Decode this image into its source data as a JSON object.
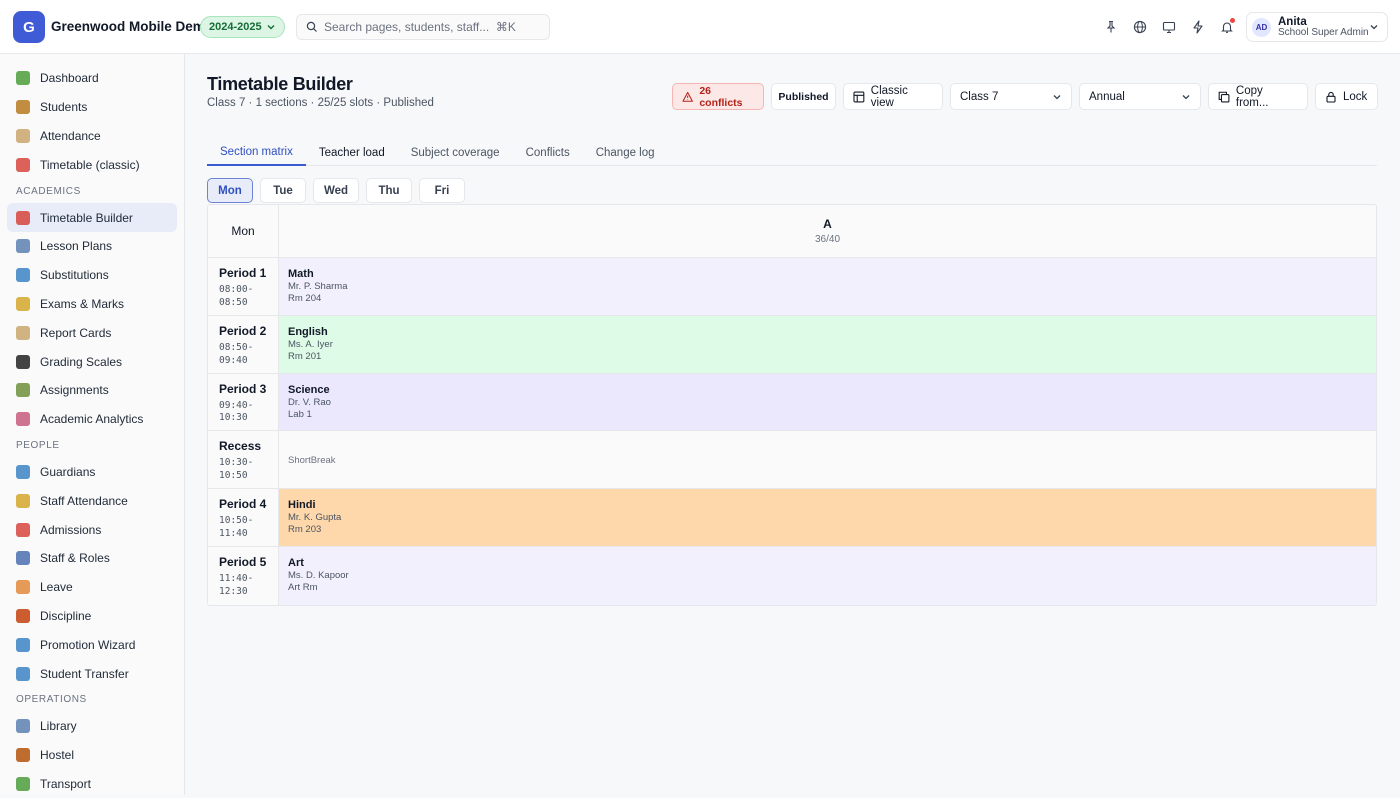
{
  "app": {
    "logo_letter": "G",
    "title": "Greenwood Mobile Demo",
    "year": "2024-2025"
  },
  "search": {
    "placeholder": "Search pages, students, staff...  ⌘K"
  },
  "user": {
    "initials": "AD",
    "name": "Anita",
    "role": "School Super Admin"
  },
  "sidebar": {
    "items_top": [
      {
        "label": "Dashboard",
        "icon": "chart-icon",
        "color": "#4a9c3b"
      },
      {
        "label": "Students",
        "icon": "student-icon",
        "color": "#b7791f"
      },
      {
        "label": "Attendance",
        "icon": "clipboard-icon",
        "color": "#c9a46b"
      },
      {
        "label": "Timetable (classic)",
        "icon": "calendar-icon",
        "color": "#d6453d"
      }
    ],
    "section_academics": "ACADEMICS",
    "items_academics": [
      {
        "label": "Timetable Builder",
        "icon": "calendar-icon",
        "color": "#d6453d"
      },
      {
        "label": "Lesson Plans",
        "icon": "book-icon",
        "color": "#5b7fb0"
      },
      {
        "label": "Substitutions",
        "icon": "refresh-icon",
        "color": "#3b82c4"
      },
      {
        "label": "Exams & Marks",
        "icon": "pencil-icon",
        "color": "#d4a72c"
      },
      {
        "label": "Report Cards",
        "icon": "clipboard-icon",
        "color": "#c9a46b"
      },
      {
        "label": "Grading Scales",
        "icon": "cap-icon",
        "color": "#222222"
      },
      {
        "label": "Assignments",
        "icon": "books-icon",
        "color": "#6c8f3a"
      },
      {
        "label": "Academic Analytics",
        "icon": "trend-icon",
        "color": "#c65b7c"
      }
    ],
    "section_people": "PEOPLE",
    "items_people": [
      {
        "label": "Guardians",
        "icon": "family-icon",
        "color": "#3b82c4"
      },
      {
        "label": "Staff Attendance",
        "icon": "staff-icon",
        "color": "#d4a72c"
      },
      {
        "label": "Admissions",
        "icon": "target-icon",
        "color": "#d6453d"
      },
      {
        "label": "Staff & Roles",
        "icon": "people-icon",
        "color": "#4b6fb0"
      },
      {
        "label": "Leave",
        "icon": "beach-icon",
        "color": "#e0883a"
      },
      {
        "label": "Discipline",
        "icon": "shield-icon",
        "color": "#c2410c"
      },
      {
        "label": "Promotion Wizard",
        "icon": "arrow-up-icon",
        "color": "#3b82c4"
      },
      {
        "label": "Student Transfer",
        "icon": "transfer-icon",
        "color": "#3b82c4"
      }
    ],
    "section_operations": "OPERATIONS",
    "items_operations": [
      {
        "label": "Library",
        "icon": "book-icon",
        "color": "#5b7fb0"
      },
      {
        "label": "Hostel",
        "icon": "house-icon",
        "color": "#b45309"
      },
      {
        "label": "Transport",
        "icon": "bus-icon",
        "color": "#4a9c3b"
      }
    ]
  },
  "page": {
    "title": "Timetable Builder",
    "subtitle": "Class 7 · 1 sections · 25/25 slots · Published"
  },
  "actions": {
    "conflicts": "26 conflicts",
    "published": "Published",
    "classic_view": "Classic view",
    "class_select": "Class 7",
    "term_select": "Annual",
    "copy_from": "Copy from...",
    "lock": "Lock"
  },
  "tabs": [
    "Section matrix",
    "Teacher load",
    "Subject coverage",
    "Conflicts",
    "Change log"
  ],
  "days": [
    "Mon",
    "Tue",
    "Wed",
    "Thu",
    "Fri"
  ],
  "grid": {
    "corner": "Mon",
    "section": {
      "name": "A",
      "count": "36/40"
    },
    "rows": [
      {
        "period": "Period 1",
        "time1": "08:00-",
        "time2": "08:50",
        "subject": "Math",
        "teacher": "Mr. P. Sharma",
        "room": "Rm 204",
        "color": "#f3f0fd"
      },
      {
        "period": "Period 2",
        "time1": "08:50-",
        "time2": "09:40",
        "subject": "English",
        "teacher": "Ms. A. Iyer",
        "room": "Rm 201",
        "color": "#ddfbe6"
      },
      {
        "period": "Period 3",
        "time1": "09:40-",
        "time2": "10:30",
        "subject": "Science",
        "teacher": "Dr. V. Rao",
        "room": "Lab 1",
        "color": "#ebe8fd"
      },
      {
        "period": "Recess",
        "time1": "10:30-",
        "time2": "10:50",
        "break_label": "ShortBreak",
        "color": "#fafafa"
      },
      {
        "period": "Period 4",
        "time1": "10:50-",
        "time2": "11:40",
        "subject": "Hindi",
        "teacher": "Mr. K. Gupta",
        "room": "Rm 203",
        "color": "#fed7aa"
      },
      {
        "period": "Period 5",
        "time1": "11:40-",
        "time2": "12:30",
        "subject": "Art",
        "teacher": "Ms. D. Kapoor",
        "room": "Art Rm",
        "color": "#f3f0fd"
      }
    ]
  }
}
